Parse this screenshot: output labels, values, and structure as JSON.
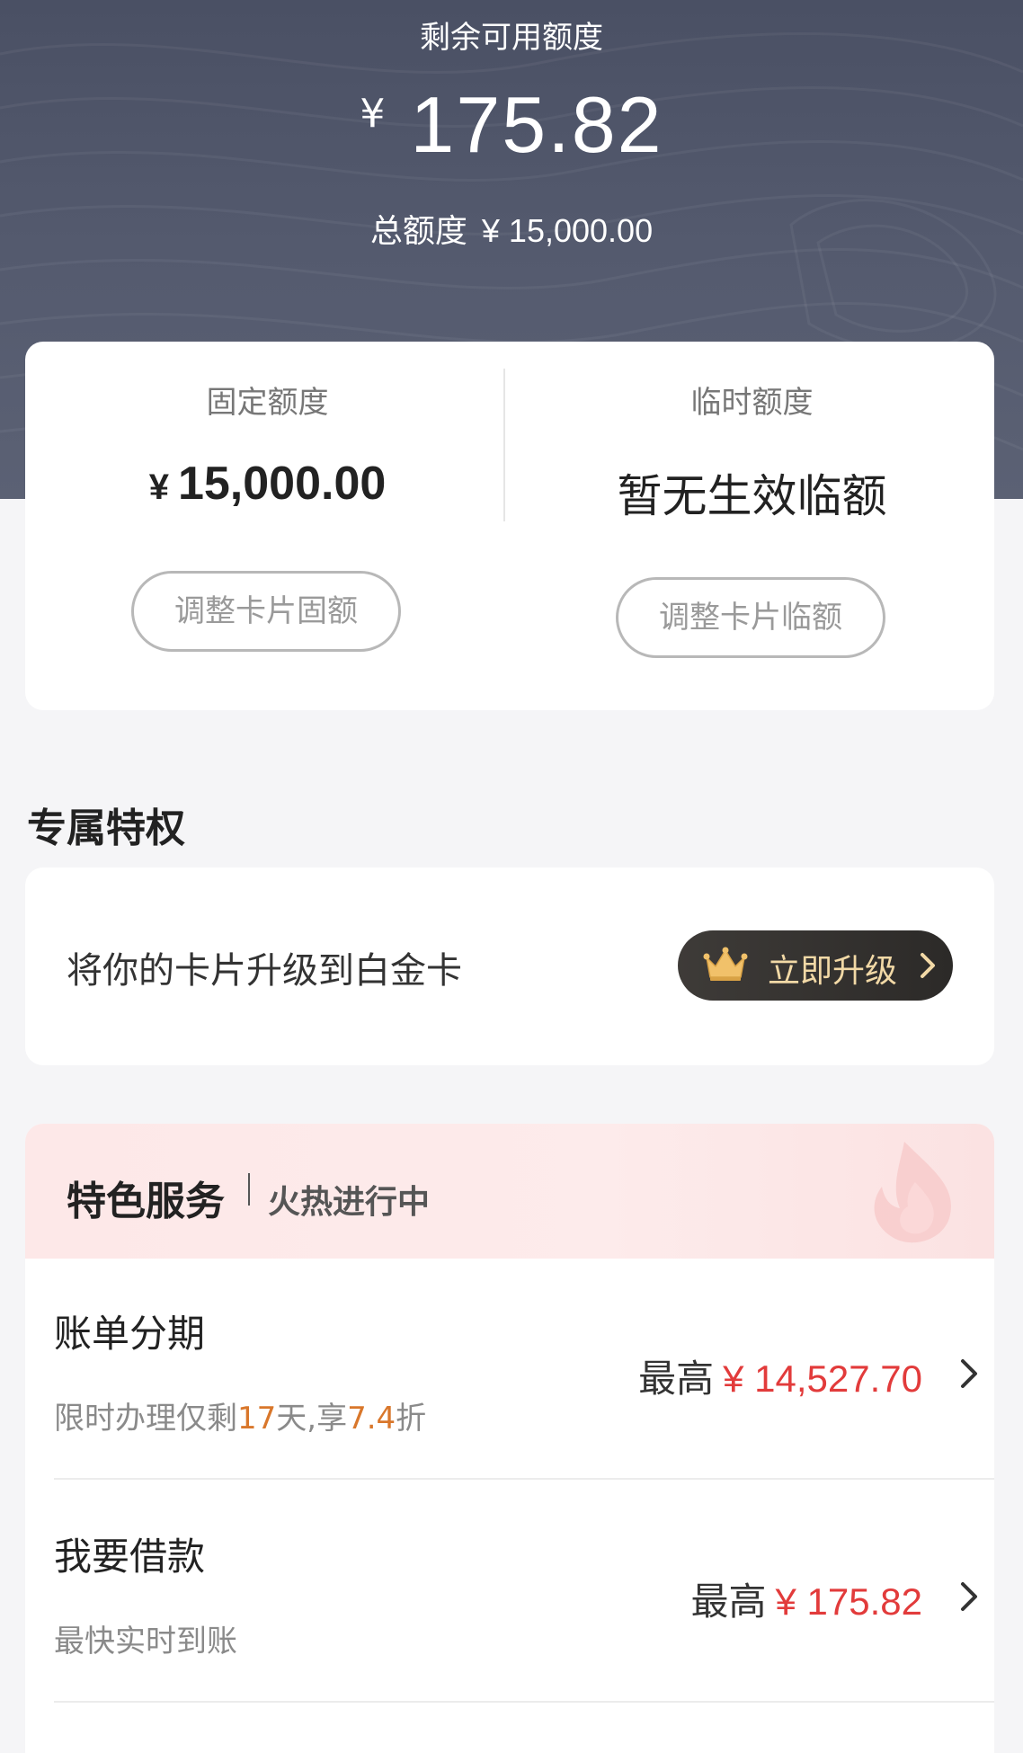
{
  "header": {
    "title": "剩余可用额度",
    "currency": "¥",
    "available": "175.82",
    "total_label": "总额度",
    "total_value": "¥ 15,000.00"
  },
  "quota": {
    "fixed": {
      "label": "固定额度",
      "currency": "¥",
      "value": "15,000.00",
      "button": "调整卡片固额"
    },
    "temporary": {
      "label": "临时额度",
      "value": "暂无生效临额",
      "button": "调整卡片临额"
    }
  },
  "privileges": {
    "section_title": "专属特权",
    "text": "将你的卡片升级到白金卡",
    "button": "立即升级",
    "icons": {
      "crown": "crown-icon",
      "chevron": "chevron-right-icon"
    }
  },
  "services": {
    "title": "特色服务",
    "subtitle": "火热进行中",
    "items": [
      {
        "name": "账单分期",
        "desc_parts": [
          "限时办理仅剩",
          "17",
          "天,享",
          "7.4",
          "折"
        ],
        "prefix": "最高",
        "amount": "¥ 14,527.70"
      },
      {
        "name": "我要借款",
        "desc": "最快实时到账",
        "prefix": "最高",
        "amount": "¥ 175.82"
      }
    ]
  },
  "colors": {
    "header_bg": "#4f5569",
    "amount_red": "#e23b3b",
    "highlight_orange": "#d9772b",
    "upgrade_btn_bg": "#36332f",
    "upgrade_btn_text": "#f2d9a6"
  }
}
